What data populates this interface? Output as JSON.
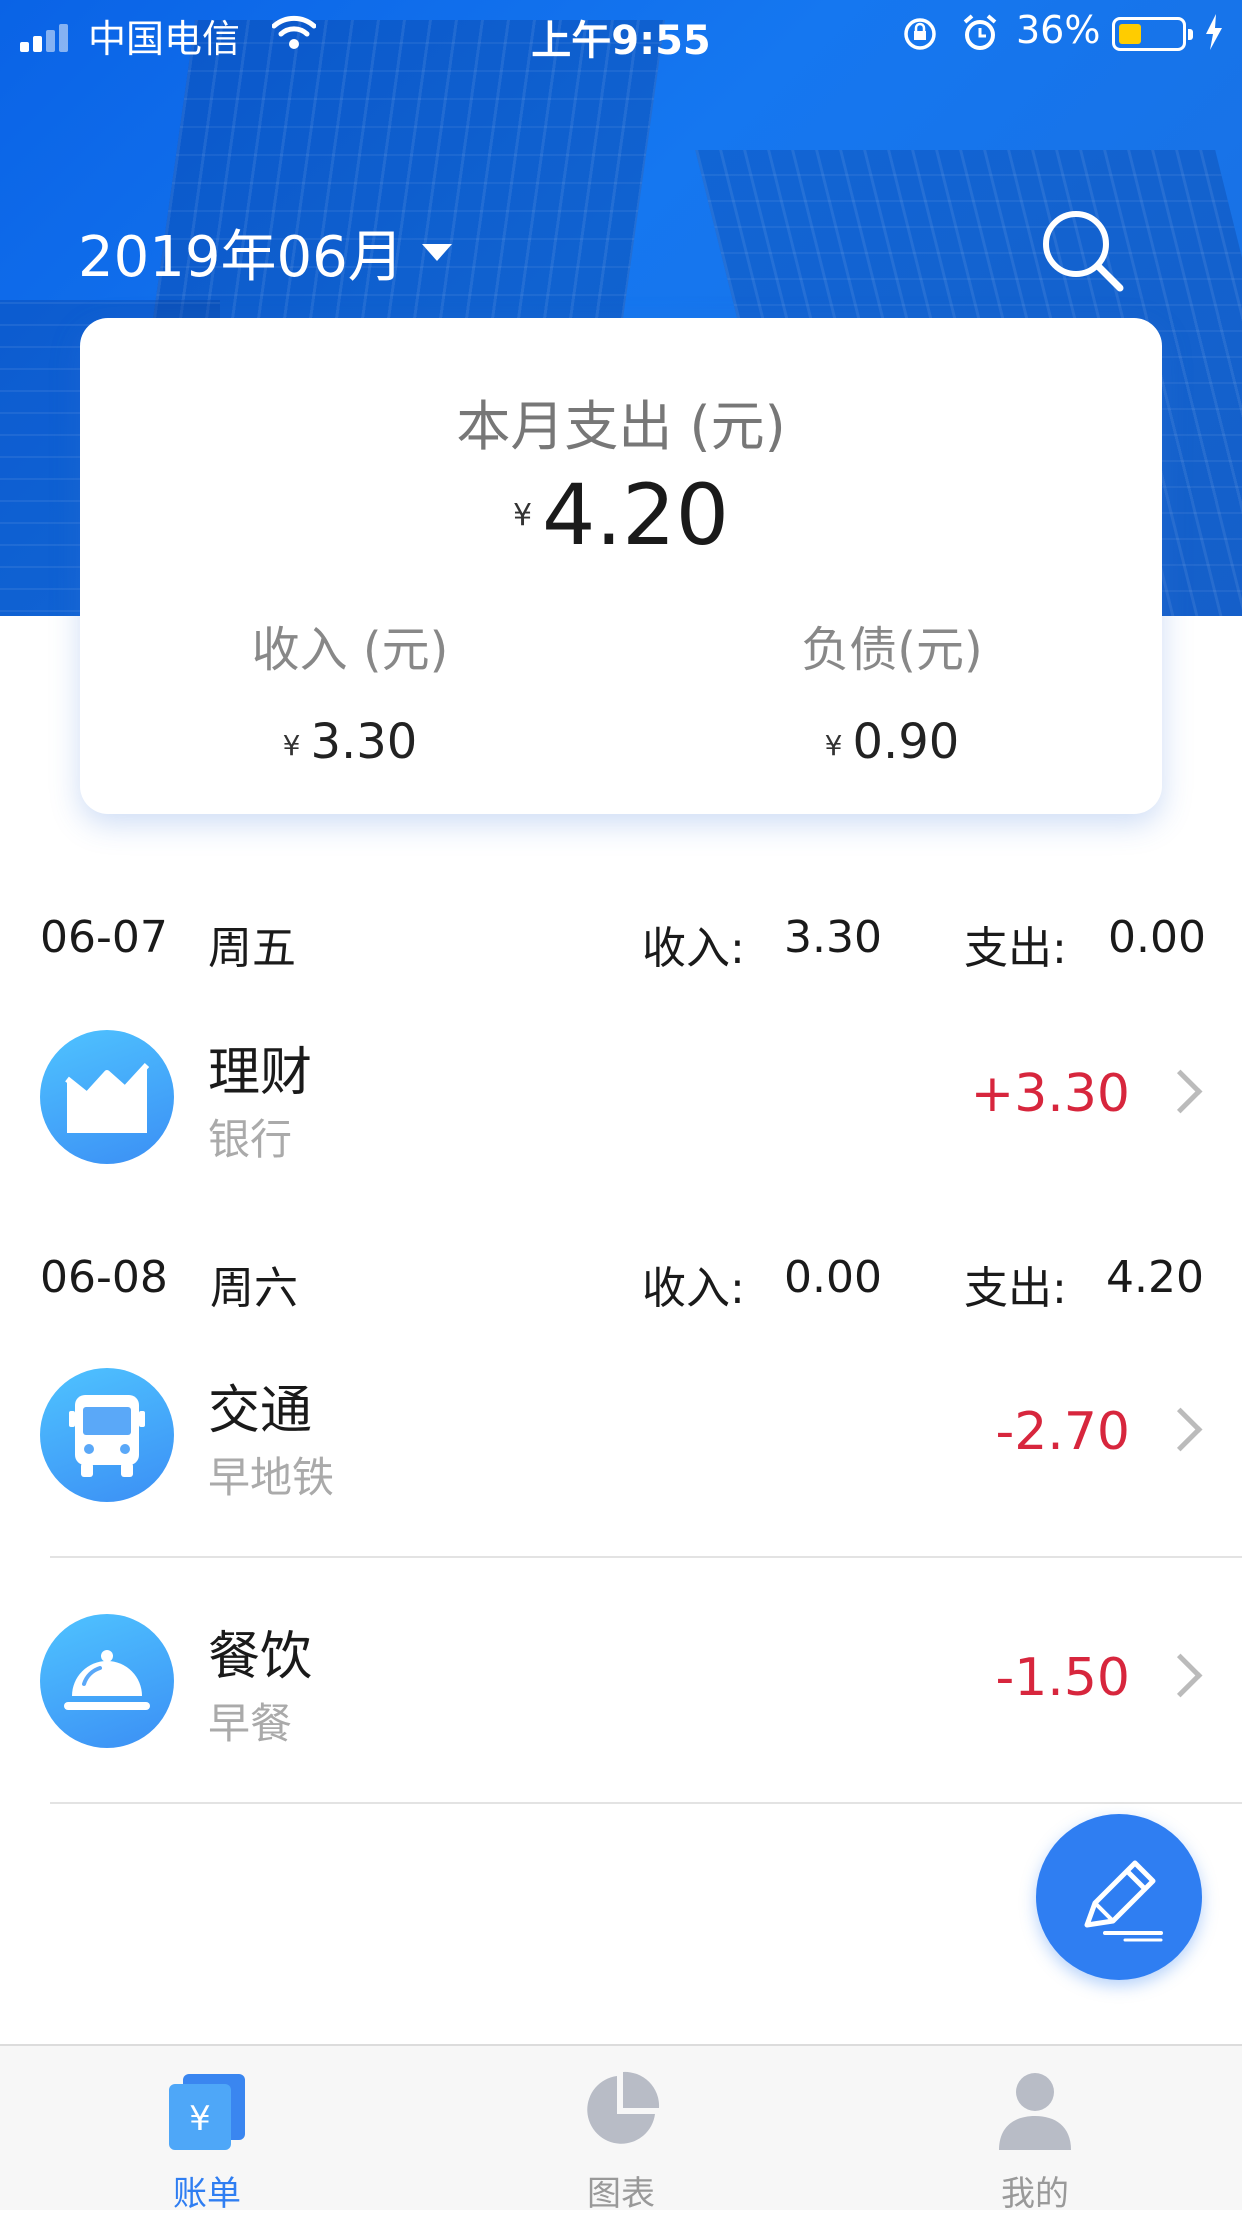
{
  "status_bar": {
    "carrier": "中国电信",
    "time": "上午9:55",
    "battery": "36%"
  },
  "header": {
    "month": "2019年06月"
  },
  "summary": {
    "title": "本月支出 (元)",
    "currency_symbol": "¥",
    "total_expense": "4.20",
    "income_label": "收入 (元)",
    "income_value": "3.30",
    "debt_label": "负债(元)",
    "debt_value": "0.90"
  },
  "days": [
    {
      "date": "06-07",
      "weekday": "周五",
      "income_label": "收入:",
      "income": "3.30",
      "expense_label": "支出:",
      "expense": "0.00",
      "records": [
        {
          "category": "理财",
          "note": "银行",
          "amount": "+3.30",
          "icon": "finance-chart-icon"
        }
      ]
    },
    {
      "date": "06-08",
      "weekday": "周六",
      "income_label": "收入:",
      "income": "0.00",
      "expense_label": "支出:",
      "expense": "4.20",
      "records": [
        {
          "category": "交通",
          "note": "早地铁",
          "amount": "-2.70",
          "icon": "bus-icon"
        },
        {
          "category": "餐饮",
          "note": "早餐",
          "amount": "-1.50",
          "icon": "food-cloche-icon"
        }
      ]
    }
  ],
  "tabbar": {
    "items": [
      {
        "label": "账单",
        "icon": "bill-icon",
        "active": true
      },
      {
        "label": "图表",
        "icon": "pie-chart-icon",
        "active": false
      },
      {
        "label": "我的",
        "icon": "profile-icon",
        "active": false
      }
    ]
  },
  "colors": {
    "primary": "#2f7ef2",
    "amount": "#d7263d",
    "muted": "#999999"
  }
}
